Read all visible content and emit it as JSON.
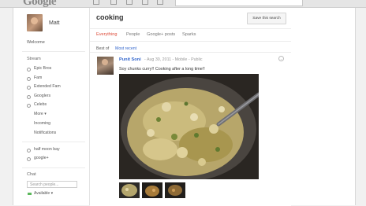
{
  "topbar": {
    "logo": "Google"
  },
  "profile": {
    "name": "Matt"
  },
  "nav": {
    "welcome": "Welcome",
    "stream": "Stream",
    "circles": [
      "Epic Bros",
      "Fam",
      "Extended Fam",
      "Googlers",
      "Celebs"
    ],
    "more": "More ▾",
    "incoming": "Incoming",
    "notifications": "Notifications",
    "saved_searches": [
      "half moon bay",
      "google+"
    ]
  },
  "chat": {
    "heading": "Chat",
    "search_placeholder": "Search people...",
    "status": "Available ▾"
  },
  "search": {
    "title": "cooking",
    "save_label": "Save this search"
  },
  "tabs": [
    "Everything",
    "People",
    "Google+ posts",
    "Sparks"
  ],
  "sort": {
    "best": "Best of",
    "recent": "Most recent"
  },
  "post": {
    "author": "Punit Soni",
    "meta": "- Aug 30, 2011 - Mobile - Public",
    "text": "Soy chunks curry!! Cooking after a long time!!"
  },
  "colors": {
    "accent_red": "#dd4b39",
    "link_blue": "#3366cc"
  }
}
